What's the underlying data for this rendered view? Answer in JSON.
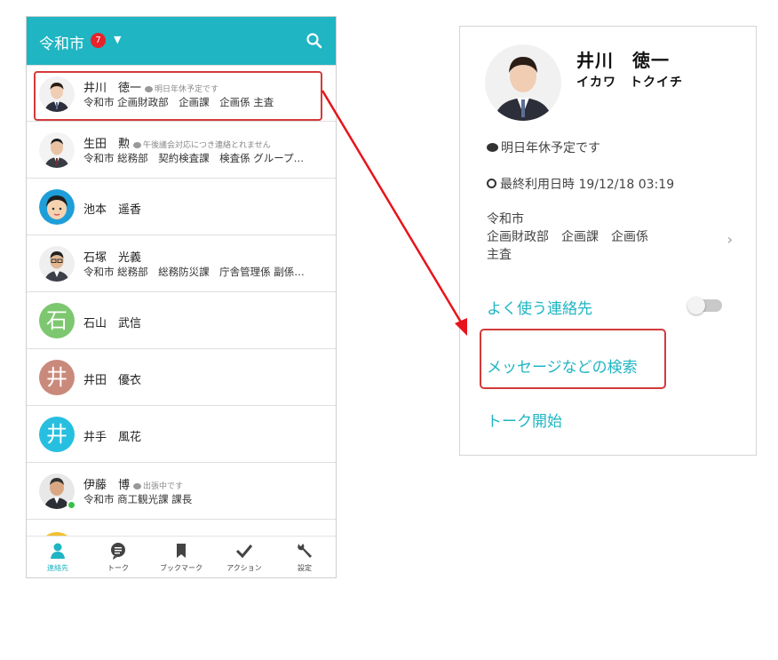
{
  "phone": {
    "title": "令和市",
    "badge": "7",
    "caret": "▼",
    "contacts": [
      {
        "name": "井川　徳一",
        "status": "明日年休予定です",
        "dept": "令和市 企画財政部　企画課　企画係 主査"
      },
      {
        "name": "生田　勲",
        "status": "午後議会対応につき連絡とれません",
        "dept": "令和市 総務部　契約検査課　検査係 グループ…"
      },
      {
        "name": "池本　遥香"
      },
      {
        "name": "石塚　光義",
        "dept": "令和市 総務部　総務防災課　庁舎管理係 副係…"
      },
      {
        "name": "石山　武信",
        "initial": "石",
        "color": "#7cc76f"
      },
      {
        "name": "井田　優衣",
        "initial": "井",
        "color": "#c98a7c"
      },
      {
        "name": "井手　風花",
        "initial": "井",
        "color": "#27bfe0"
      },
      {
        "name": "伊藤　博",
        "status": "出張中です",
        "dept": "令和市 商工観光課 課長"
      }
    ],
    "tabs": [
      "連絡先",
      "トーク",
      "ブックマーク",
      "アクション",
      "設定"
    ],
    "accent": "#1fb5c3"
  },
  "detail": {
    "name": "井川　徳一",
    "kana": "イカワ　トクイチ",
    "status": "明日年休予定です",
    "last_used": "最終利用日時 19/12/18 03:19",
    "org_line1": "令和市",
    "org_line2": "企画財政部　企画課　企画係",
    "org_line3": "主査",
    "favorite_label": "よく使う連絡先",
    "message_search": "メッセージなどの検索",
    "start_talk": "トーク開始",
    "chevron": "›"
  }
}
